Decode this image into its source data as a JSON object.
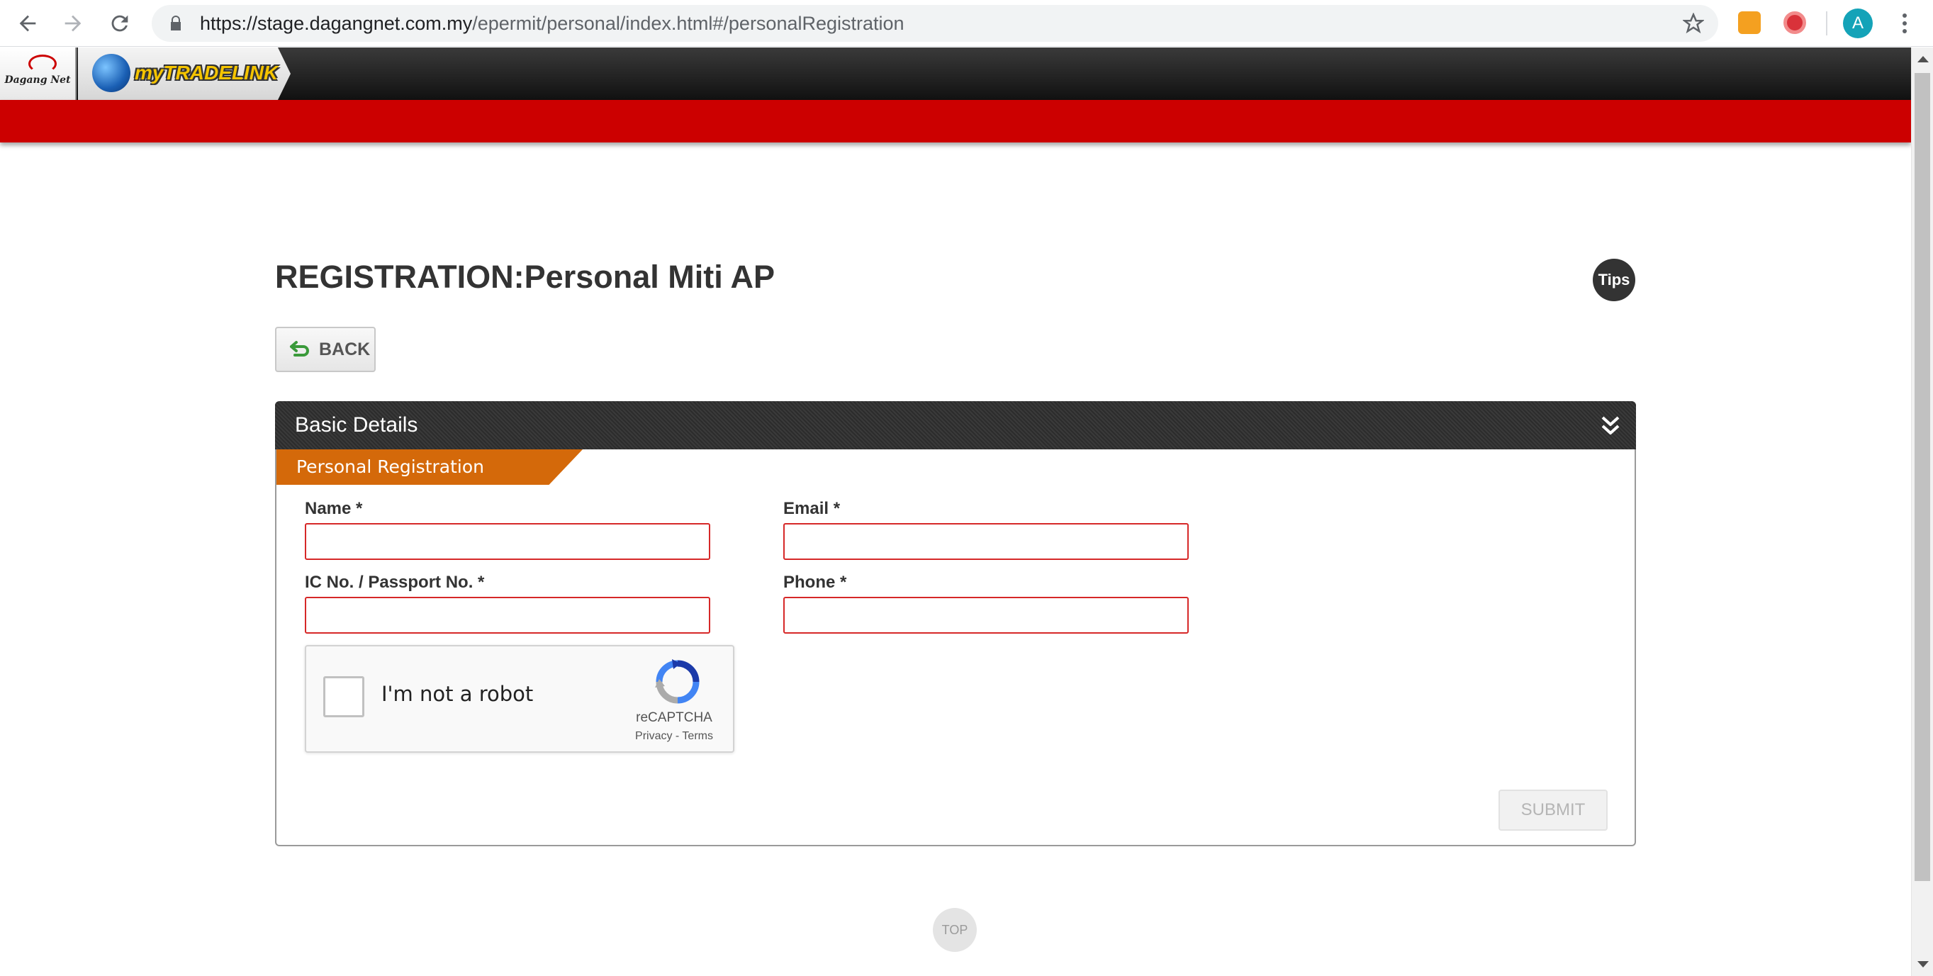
{
  "browser": {
    "url_host": "https://stage.dagangnet.com.my",
    "url_path": "/epermit/personal/index.html#/personalRegistration",
    "avatar_letter": "A"
  },
  "header": {
    "logo_text": "Dagang Net",
    "brand": "myTRADELINK",
    "accent_color": "#cc0000"
  },
  "page": {
    "title": "REGISTRATION:Personal Miti AP",
    "tips_label": "Tips",
    "back_label": "BACK",
    "top_label": "TOP"
  },
  "panel": {
    "title": "Basic Details",
    "section": "Personal Registration",
    "fields": {
      "name_label": "Name *",
      "name_value": "",
      "email_label": "Email *",
      "email_value": "",
      "ic_label": "IC No. / Passport No. *",
      "ic_value": "",
      "phone_label": "Phone *",
      "phone_value": ""
    },
    "recaptcha": {
      "label": "I'm not a robot",
      "brand": "reCAPTCHA",
      "links": "Privacy - Terms"
    },
    "submit_label": "SUBMIT"
  }
}
